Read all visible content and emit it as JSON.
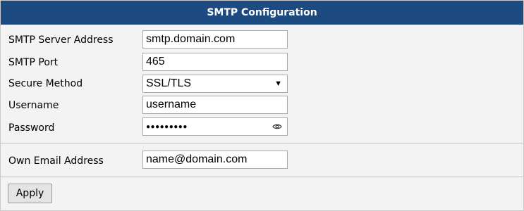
{
  "header": {
    "title": "SMTP Configuration"
  },
  "form": {
    "server_label": "SMTP Server Address",
    "server_value": "smtp.domain.com",
    "port_label": "SMTP Port",
    "port_value": "465",
    "secure_label": "Secure Method",
    "secure_value": "SSL/TLS",
    "username_label": "Username",
    "username_value": "username",
    "password_label": "Password",
    "password_mask": "●●●●●●●●●",
    "email_label": "Own Email Address",
    "email_value": "name@domain.com"
  },
  "actions": {
    "apply_label": "Apply"
  },
  "colors": {
    "header_bg": "#1d4a80",
    "panel_bg": "#f3f3f3"
  },
  "icons": {
    "secure_dropdown": "chevron-down-icon",
    "password_toggle": "eye-icon"
  }
}
